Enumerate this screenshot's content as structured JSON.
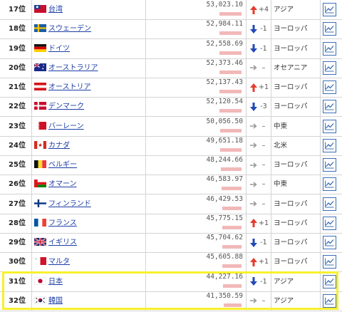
{
  "colors": {
    "up": "#e63b2e",
    "down": "#2348b7",
    "flat": "#9a9a9a",
    "highlight": "#f7f02d",
    "link": "#1a3da6"
  },
  "rows": [
    {
      "rank": "17位",
      "flag": "taiwan",
      "country": "台湾",
      "value": "53,023.10",
      "bar": 0.7,
      "trend": "up",
      "change": "+4",
      "region": "アジア"
    },
    {
      "rank": "18位",
      "flag": "sweden",
      "country": "スウェーデン",
      "value": "52,984.11",
      "bar": 0.7,
      "trend": "down",
      "change": "-1",
      "region": "ヨーロッパ"
    },
    {
      "rank": "19位",
      "flag": "germany",
      "country": "ドイツ",
      "value": "52,558.69",
      "bar": 0.69,
      "trend": "down",
      "change": "-1",
      "region": "ヨーロッパ"
    },
    {
      "rank": "20位",
      "flag": "australia",
      "country": "オーストラリア",
      "value": "52,373.46",
      "bar": 0.69,
      "trend": "flat",
      "change": "–",
      "region": "オセアニア"
    },
    {
      "rank": "21位",
      "flag": "austria",
      "country": "オーストリア",
      "value": "52,137.43",
      "bar": 0.69,
      "trend": "up",
      "change": "+1",
      "region": "ヨーロッパ"
    },
    {
      "rank": "22位",
      "flag": "denmark",
      "country": "デンマーク",
      "value": "52,120.54",
      "bar": 0.69,
      "trend": "down",
      "change": "-3",
      "region": "ヨーロッパ"
    },
    {
      "rank": "23位",
      "flag": "bahrain",
      "country": "バーレーン",
      "value": "50,056.50",
      "bar": 0.66,
      "trend": "flat",
      "change": "–",
      "region": "中東"
    },
    {
      "rank": "24位",
      "flag": "canada",
      "country": "カナダ",
      "value": "49,651.18",
      "bar": 0.66,
      "trend": "flat",
      "change": "–",
      "region": "北米"
    },
    {
      "rank": "25位",
      "flag": "belgium",
      "country": "ベルギー",
      "value": "48,244.66",
      "bar": 0.64,
      "trend": "flat",
      "change": "–",
      "region": "ヨーロッパ"
    },
    {
      "rank": "26位",
      "flag": "oman",
      "country": "オマーン",
      "value": "46,583.97",
      "bar": 0.62,
      "trend": "flat",
      "change": "–",
      "region": "中東"
    },
    {
      "rank": "27位",
      "flag": "finland",
      "country": "フィンランド",
      "value": "46,429.53",
      "bar": 0.61,
      "trend": "flat",
      "change": "–",
      "region": "ヨーロッパ"
    },
    {
      "rank": "28位",
      "flag": "france",
      "country": "フランス",
      "value": "45,775.15",
      "bar": 0.61,
      "trend": "up",
      "change": "+1",
      "region": "ヨーロッパ"
    },
    {
      "rank": "29位",
      "flag": "uk",
      "country": "イギリス",
      "value": "45,704.62",
      "bar": 0.61,
      "trend": "down",
      "change": "-1",
      "region": "ヨーロッパ"
    },
    {
      "rank": "30位",
      "flag": "malta",
      "country": "マルタ",
      "value": "45,605.88",
      "bar": 0.6,
      "trend": "up",
      "change": "+1",
      "region": "ヨーロッパ"
    },
    {
      "rank": "31位",
      "flag": "japan",
      "country": "日本",
      "value": "44,227.16",
      "bar": 0.58,
      "trend": "down",
      "change": "-1",
      "region": "アジア"
    },
    {
      "rank": "32位",
      "flag": "korea",
      "country": "韓国",
      "value": "41,350.59",
      "bar": 0.55,
      "trend": "flat",
      "change": "–",
      "region": "アジア"
    }
  ]
}
